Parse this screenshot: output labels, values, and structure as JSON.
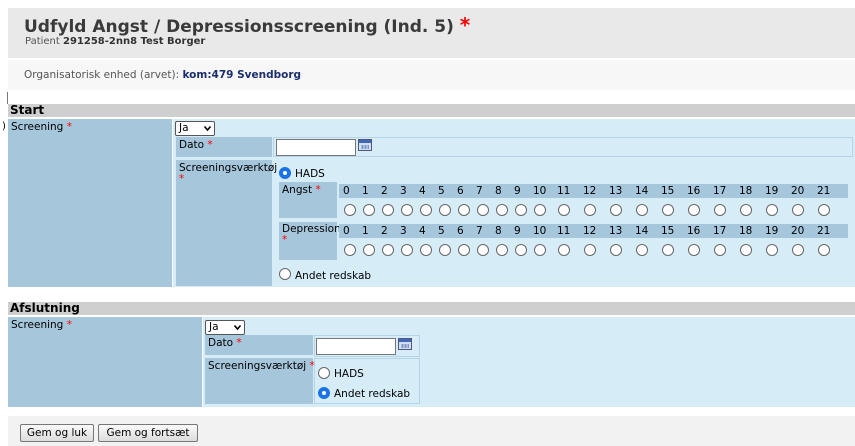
{
  "header": {
    "title": "Udfyld Angst / Depressionsscreening (Ind. 5)",
    "required_mark": "*",
    "patient_prefix": "Patient ",
    "patient_id": "291258-2nn8 Test Borger"
  },
  "org": {
    "label": "Organisatorisk enhed (arvet): ",
    "value": "kom:479 Svendborg"
  },
  "left_mark": ")",
  "start": {
    "section_title": "Start",
    "screening_label": "Screening",
    "screening_value": "Ja",
    "dato_label": "Dato",
    "dato_value": "",
    "tool_label": "Screeningsværktøj",
    "hads_label": "HADS",
    "hads_selected": true,
    "angst_label": "Angst",
    "depression_label": "Depression",
    "scale": [
      "0",
      "1",
      "2",
      "3",
      "4",
      "5",
      "6",
      "7",
      "8",
      "9",
      "10",
      "11",
      "12",
      "13",
      "14",
      "15",
      "16",
      "17",
      "18",
      "19",
      "20",
      "21"
    ],
    "andet_label": "Andet redskab",
    "andet_selected": false
  },
  "afslutning": {
    "section_title": "Afslutning",
    "screening_label": "Screening",
    "screening_value": "Ja",
    "dato_label": "Dato",
    "dato_value": "",
    "tool_label": "Screeningsværktøj",
    "hads_label": "HADS",
    "hads_selected": false,
    "andet_label": "Andet redskab",
    "andet_selected": true
  },
  "buttons": {
    "save_close": "Gem og luk",
    "save_continue": "Gem og fortsæt"
  },
  "colors": {
    "light_blue": "#d6edf8",
    "steel_blue": "#a6c6dc",
    "required": "#ff0000",
    "radio_selected": "#1a73e8"
  }
}
